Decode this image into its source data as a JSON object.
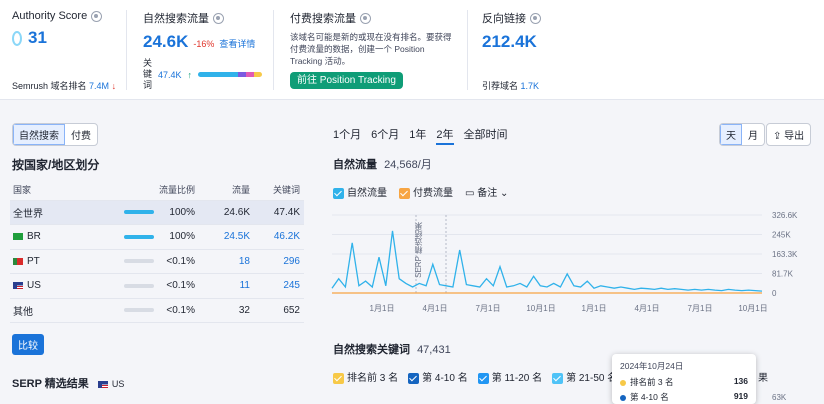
{
  "authority": {
    "title": "Authority Score",
    "value": "31",
    "rank_label": "Semrush 域名排名",
    "rank_value": "7.4M",
    "rank_arrow": "↓"
  },
  "organic": {
    "title": "自然搜索流量",
    "value": "24.6K",
    "change": "-16%",
    "detail_link": "查看详情",
    "kw_label": "关键词",
    "kw_value": "47.4K",
    "kw_arrow": "↑"
  },
  "paid": {
    "title": "付费搜索流量",
    "desc": "该域名可能是新的或现在没有排名。要获得付费流量的数据，创建一个 Position Tracking 活动。",
    "button": "前往 Position Tracking"
  },
  "backlinks": {
    "title": "反向链接",
    "value": "212.4K",
    "ref_label": "引荐域名",
    "ref_value": "1.7K"
  },
  "left": {
    "tabs": [
      "自然搜索",
      "付费"
    ],
    "section_title": "按国家/地区划分",
    "columns": [
      "国家",
      "流量比例",
      "流量",
      "关键词"
    ],
    "rows": [
      {
        "country": "全世界",
        "share": "100%",
        "traffic": "24.6K",
        "keywords": "47.4K",
        "share_fill": 1.0
      },
      {
        "country": "BR",
        "share": "100%",
        "traffic": "24.5K",
        "keywords": "46.2K",
        "share_fill": 1.0
      },
      {
        "country": "PT",
        "share": "<0.1%",
        "traffic": "18",
        "keywords": "296",
        "share_fill": 0.0
      },
      {
        "country": "US",
        "share": "<0.1%",
        "traffic": "11",
        "keywords": "245",
        "share_fill": 0.0
      },
      {
        "country": "其他",
        "share": "<0.1%",
        "traffic": "32",
        "keywords": "652",
        "share_fill": 0.0
      }
    ],
    "compare_button": "比较",
    "serp_title": "SERP 精选结果",
    "serp_country": "US"
  },
  "periods": [
    "1个月",
    "6个月",
    "1年",
    "2年",
    "全部时间"
  ],
  "active_period": "2年",
  "granularity": [
    "天",
    "月"
  ],
  "export_label": "导出",
  "traffic_chart": {
    "title": "自然流量",
    "value": "24,568/月",
    "legend": [
      "自然流量",
      "付费流量"
    ],
    "notes_label": "备注",
    "serp_annotation": "SERP 精选结果"
  },
  "chart_data": {
    "type": "line",
    "x_ticks": [
      "1月1日",
      "4月1日",
      "7月1日",
      "10月1日",
      "1月1日",
      "4月1日",
      "7月1日",
      "10月1日"
    ],
    "y_ticks": [
      "326.6K",
      "245K",
      "163.3K",
      "81.7K",
      "0"
    ],
    "ylim": [
      0,
      326600
    ],
    "grid": true,
    "series": [
      {
        "name": "自然流量",
        "color": "#30b2ea",
        "values": [
          20000,
          60000,
          25000,
          210000,
          30000,
          50000,
          25000,
          150000,
          30000,
          260000,
          60000,
          40000,
          25000,
          40000,
          30000,
          120000,
          35000,
          30000,
          25000,
          180000,
          35000,
          30000,
          25000,
          60000,
          30000,
          110000,
          25000,
          30000,
          40000,
          25000,
          70000,
          30000,
          25000,
          40000,
          25000,
          80000,
          30000,
          25000,
          50000,
          20000,
          30000,
          25000,
          20000,
          25000,
          20000,
          15000,
          20000,
          18000,
          15000,
          20000,
          15000,
          18000,
          15000,
          12000,
          15000,
          12000,
          15000,
          12000,
          10000,
          15000,
          12000,
          10000,
          12000,
          10000,
          8000
        ]
      },
      {
        "name": "付费流量",
        "color": "#f7a543",
        "values": [
          0,
          0,
          0,
          0,
          0,
          0,
          0,
          0,
          0,
          0,
          0,
          0,
          0,
          0,
          0,
          0,
          0,
          0,
          0,
          0,
          0,
          0,
          0,
          0,
          0,
          0,
          0,
          0,
          0,
          0,
          0,
          0,
          0,
          0,
          0,
          0,
          0,
          0,
          0,
          0,
          0,
          0,
          0,
          0,
          0,
          0,
          0,
          0,
          0,
          0,
          0,
          0,
          0,
          0,
          0,
          0,
          0,
          0,
          0,
          0,
          0,
          0,
          0,
          0,
          0
        ]
      }
    ]
  },
  "keywords_section": {
    "title": "自然搜索关键词",
    "value": "47,431",
    "filters": [
      "排名前 3 名",
      "第 4-10 名",
      "第 11-20 名",
      "第 21-50 名"
    ],
    "filter_colors": [
      "#f7c948",
      "#1565c0",
      "#2196f3",
      "#4fc3f7"
    ],
    "extra": "果",
    "axis_hint": "63K"
  },
  "tooltip": {
    "date": "2024年10月24日",
    "rows": [
      {
        "label": "排名前 3 名",
        "value": "136",
        "color": "#f7c948"
      },
      {
        "label": "第 4-10 名",
        "value": "919",
        "color": "#1565c0"
      }
    ]
  }
}
